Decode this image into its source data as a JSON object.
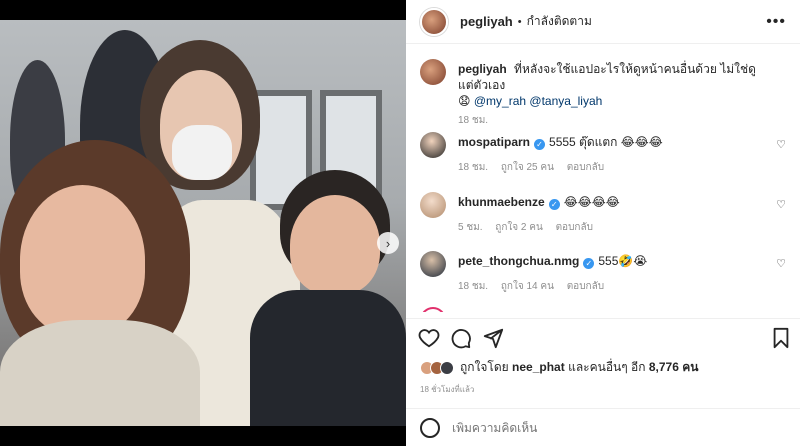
{
  "post": {
    "username": "pegliyah",
    "dot": "•",
    "follow_status": "กำลังติดตาม",
    "more_icon": "more-horizontal-icon"
  },
  "caption": {
    "username": "pegliyah",
    "text": "ที่หลังจะใช้แอปอะไรให้ดูหน้าคนอื่นด้วย ไม่ใช่ดูแต่ตัวเอง",
    "emoji": "😧",
    "mentions": [
      "@my_rah",
      "@tanya_liyah"
    ],
    "time": "18 ชม."
  },
  "comments": [
    {
      "username": "mospatiparn",
      "verified": true,
      "text": "5555 ตุ๊ดแตก 😂😂😂",
      "time": "18 ชม.",
      "likes": "ถูกใจ 25 คน",
      "reply": "ตอบกลับ"
    },
    {
      "username": "khunmaebenze",
      "verified": true,
      "text": "😂😂😂😂",
      "time": "5 ชม.",
      "likes": "ถูกใจ 2 คน",
      "reply": "ตอบกลับ"
    },
    {
      "username": "pete_thongchua.nmg",
      "verified": true,
      "text": "555🤣😭",
      "time": "18 ชม.",
      "likes": "ถูกใจ 14 คน",
      "reply": "ตอบกลับ"
    }
  ],
  "actions": {
    "like_icon": "heart-icon",
    "comment_icon": "comment-icon",
    "share_icon": "share-icon",
    "save_icon": "bookmark-icon"
  },
  "likes": {
    "prefix": "ถูกใจโดย",
    "user": "nee_phat",
    "middle": "และคนอื่นๆ อีก",
    "count": "8,776 คน"
  },
  "timestamp": "18 ชั่วโมงที่แล้ว",
  "add_comment": {
    "placeholder": "เพิ่มความคิดเห็น",
    "post_label": ""
  },
  "colors": {
    "verified": "#3897f0",
    "mention": "#00376b",
    "meta": "#8e8e8e"
  }
}
